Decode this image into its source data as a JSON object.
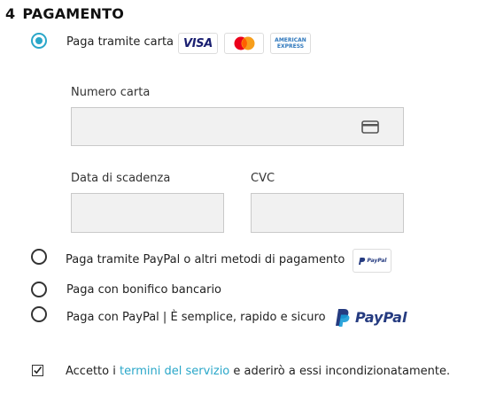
{
  "section": {
    "number": "4",
    "title": "PAGAMENTO"
  },
  "card_option": {
    "label": "Paga tramite carta",
    "selected": true,
    "logos": [
      "visa-logo",
      "mastercard-logo",
      "amex-logo"
    ],
    "visa_text": "VISA",
    "amex_text_line1": "AMERICAN",
    "amex_text_line2": "EXPRESS"
  },
  "card_form": {
    "number_label": "Numero carta",
    "expiry_label": "Data di scadenza",
    "cvc_label": "CVC"
  },
  "options": [
    {
      "label": "Paga tramite PayPal o altri metodi di pagamento",
      "selected": false,
      "badge": "PayPal"
    },
    {
      "label": "Paga con bonifico bancario",
      "selected": false
    },
    {
      "label": "Paga con PayPal | È semplice, rapido e sicuro",
      "selected": false,
      "brand": "PayPal"
    }
  ],
  "terms": {
    "checked": true,
    "text_before": "Accetto i ",
    "link_text": "termini del servizio",
    "text_after": " e aderirò a essi incondizionatamente."
  },
  "colors": {
    "accent": "#2aa7c9",
    "paypal_dark": "#253b80",
    "paypal_light": "#179bd7",
    "visa_blue": "#1a1f71"
  }
}
